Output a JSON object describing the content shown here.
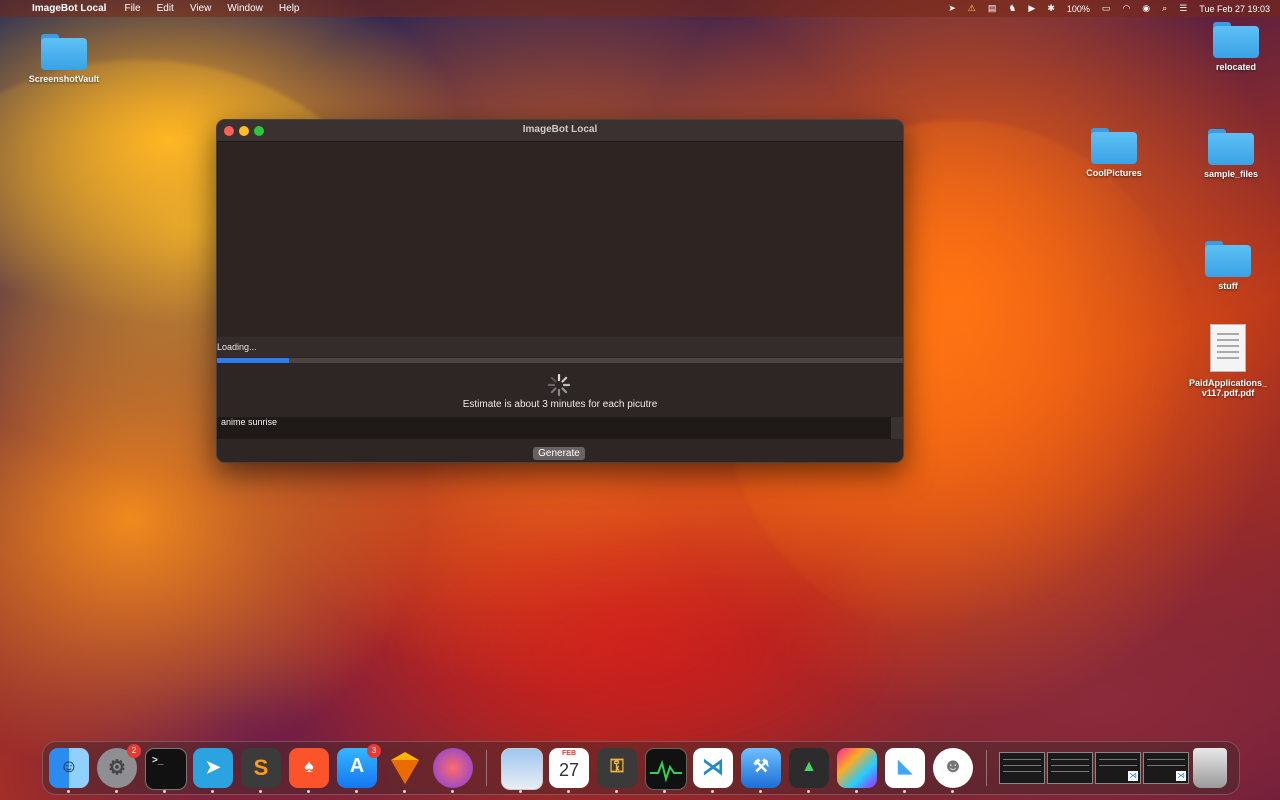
{
  "menubar": {
    "app_name": "ImageBot Local",
    "items": [
      "File",
      "Edit",
      "View",
      "Window",
      "Help"
    ],
    "battery": "100%",
    "clock": "Tue Feb 27  19:03"
  },
  "desktop_icons": {
    "screenshot_vault": "ScreenshotVault",
    "relocated": "relocated",
    "cool_pictures": "CoolPictures",
    "sample_files": "sample_files",
    "stuff": "stuff",
    "pdf_line1": "PaidApplications_",
    "pdf_line2": "v117.pdf.pdf"
  },
  "window": {
    "title": "ImageBot Local",
    "loading_label": "Loading...",
    "progress": 0.105,
    "estimate": "Estimate is about 3 minutes for each picutre",
    "prompt_value": "anime sunrise",
    "generate_label": "Generate"
  },
  "dock": {
    "settings_badge": "2",
    "appstore_badge": "3",
    "calendar_month": "FEB",
    "calendar_day": "27"
  },
  "colors": {
    "accent": "#2f7bf0",
    "close": "#fe5f57",
    "minimize": "#febc2e",
    "maximize": "#28c840",
    "folder": "#5ec0f5"
  }
}
